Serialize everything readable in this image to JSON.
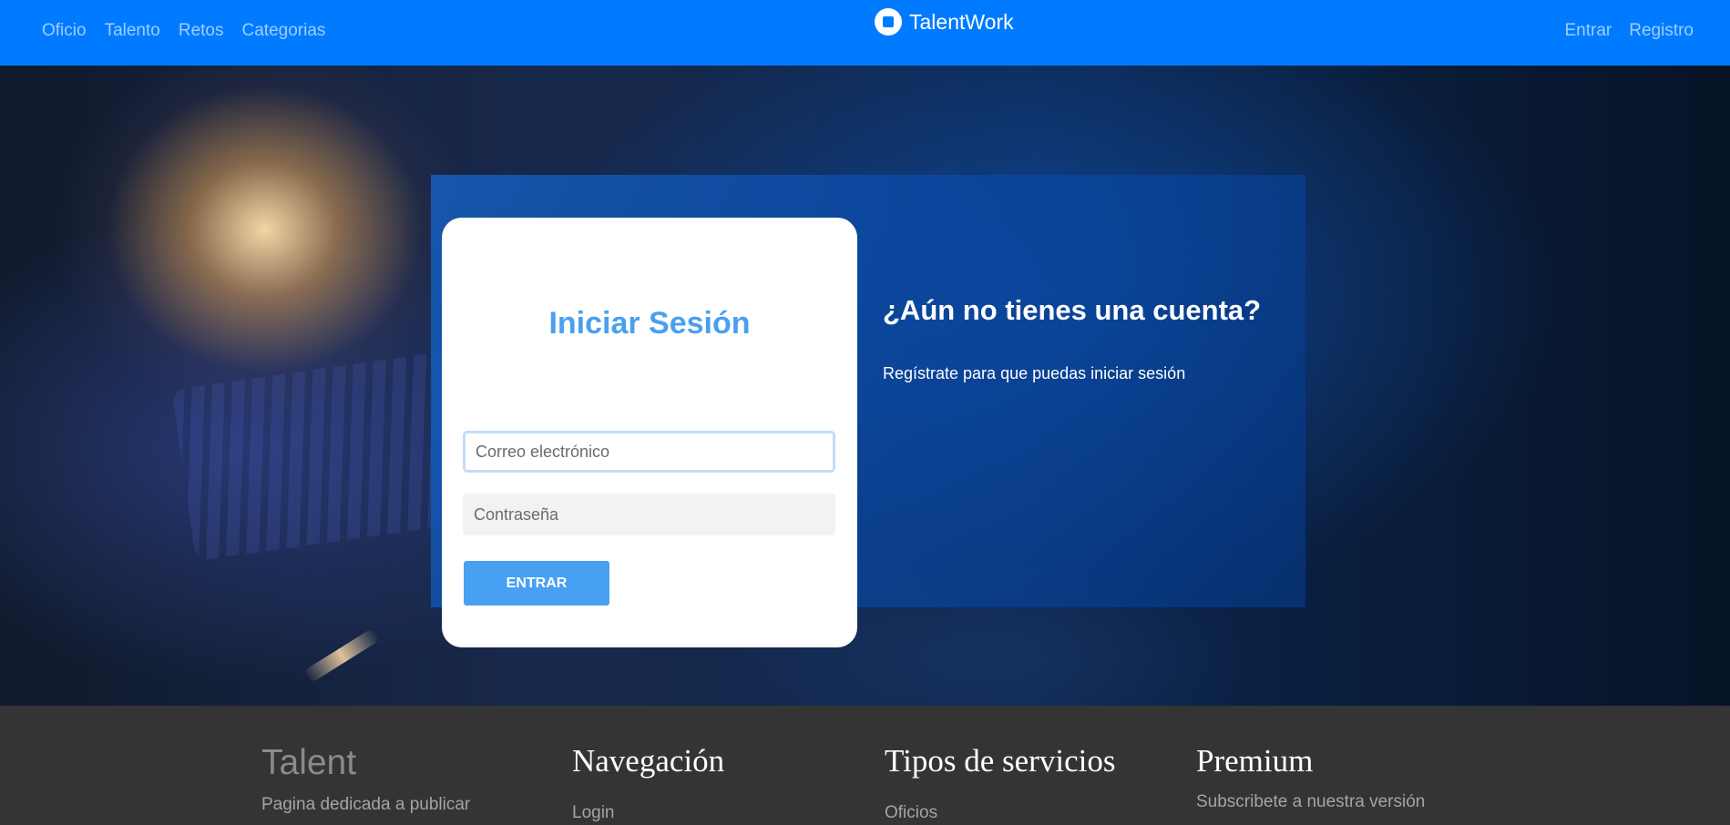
{
  "navbar": {
    "left_links": [
      "Oficio",
      "Talento",
      "Retos",
      "Categorias"
    ],
    "brand": "TalentWork",
    "brand_icon": "stop-circle-icon",
    "right_links": [
      "Entrar",
      "Registro"
    ]
  },
  "login": {
    "title": "Iniciar Sesión",
    "email_placeholder": "Correo electrónico",
    "password_placeholder": "Contraseña",
    "submit_label": "ENTRAR"
  },
  "signup_prompt": {
    "title": "¿Aún no tienes una cuenta?",
    "text": "Regístrate para que puedas iniciar sesión"
  },
  "footer": {
    "talent": {
      "title": "Talent",
      "description": "Pagina dedicada a publicar"
    },
    "navigation": {
      "title": "Navegación",
      "links": [
        "Login"
      ]
    },
    "service_types": {
      "title": "Tipos de servicios",
      "links": [
        "Oficios"
      ]
    },
    "premium": {
      "title": "Premium",
      "description": "Subscribete a nuestra versión"
    }
  },
  "colors": {
    "navbar": "#007bff",
    "login_title": "#4aa0ef",
    "button": "#48a0f2",
    "footer": "#343434"
  }
}
